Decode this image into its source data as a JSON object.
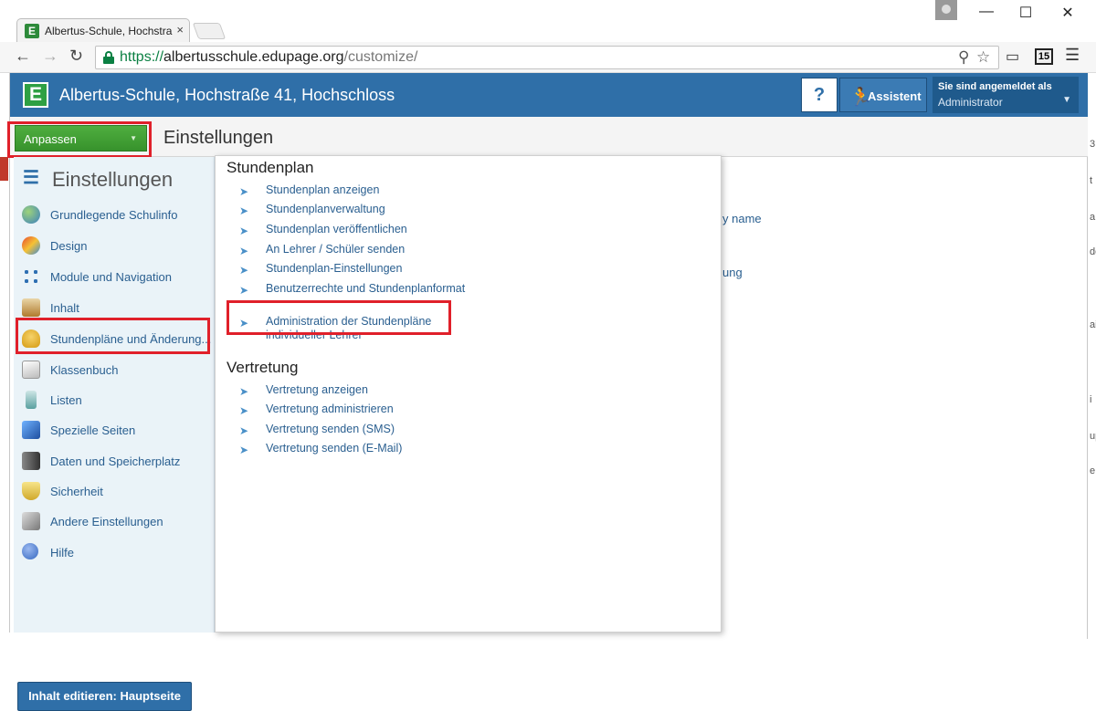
{
  "browser": {
    "tab_title": "Albertus-Schule, Hochstra",
    "tab_favicon": "E",
    "tab_close": "×",
    "url_protocol": "https://",
    "url_host": "albertusschule.edupage.org",
    "url_path": "/customize/",
    "badge": "15"
  },
  "header": {
    "logo_letter": "E",
    "site_title": "Albertus-Schule, Hochstraße 41, Hochschloss",
    "help_label": "?",
    "assistant_label": "Assistent",
    "login_label": "Sie sind angemeldet als",
    "login_user": "Administrator"
  },
  "subbar": {
    "customize_label": "Anpassen",
    "title": "Einstellungen"
  },
  "sidebar": {
    "heading": "Einstellungen",
    "items": [
      {
        "label": "Grundlegende Schulinfo",
        "icon": "globe-icon",
        "color": "#3a7fc0"
      },
      {
        "label": "Design",
        "icon": "palette-icon",
        "color": "#d04b2a"
      },
      {
        "label": "Module und Navigation",
        "icon": "network-icon",
        "color": "#2e6fb2"
      },
      {
        "label": "Inhalt",
        "icon": "easel-icon",
        "color": "#b07a2c"
      },
      {
        "label": "Stundenpläne und Änderung...",
        "icon": "bell-icon",
        "color": "#e0a81e"
      },
      {
        "label": "Klassenbuch",
        "icon": "book-icon",
        "color": "#8c8c8c"
      },
      {
        "label": "Listen",
        "icon": "list-icon",
        "color": "#5aa0a0"
      },
      {
        "label": "Spezielle Seiten",
        "icon": "cube-icon",
        "color": "#1f6fd0"
      },
      {
        "label": "Daten und Speicherplatz",
        "icon": "server-icon",
        "color": "#5a5a5a"
      },
      {
        "label": "Sicherheit",
        "icon": "shield-icon",
        "color": "#e0c23a"
      },
      {
        "label": "Andere Einstellungen",
        "icon": "tools-icon",
        "color": "#8a8a8a"
      },
      {
        "label": "Hilfe",
        "icon": "help-icon",
        "color": "#3568c0"
      }
    ],
    "edit_button": "Inhalt editieren: Hauptseite"
  },
  "background_fragments": [
    "y name",
    "ung"
  ],
  "dropdown": {
    "stundenplan_heading": "Stundenplan",
    "stundenplan_items": [
      "Stundenplan anzeigen",
      "Stundenplanverwaltung",
      "Stundenplan veröffentlichen",
      "An Lehrer / Schüler senden",
      "Stundenplan-Einstellungen",
      "Benutzerrechte und Stundenplanformat",
      "Administration der Stundenpläne individueller Lehrer"
    ],
    "vertretung_heading": "Vertretung",
    "vertretung_items": [
      "Vertretung anzeigen",
      "Vertretung administrieren",
      "Vertretung senden (SMS)",
      "Vertretung senden (E-Mail)"
    ]
  }
}
